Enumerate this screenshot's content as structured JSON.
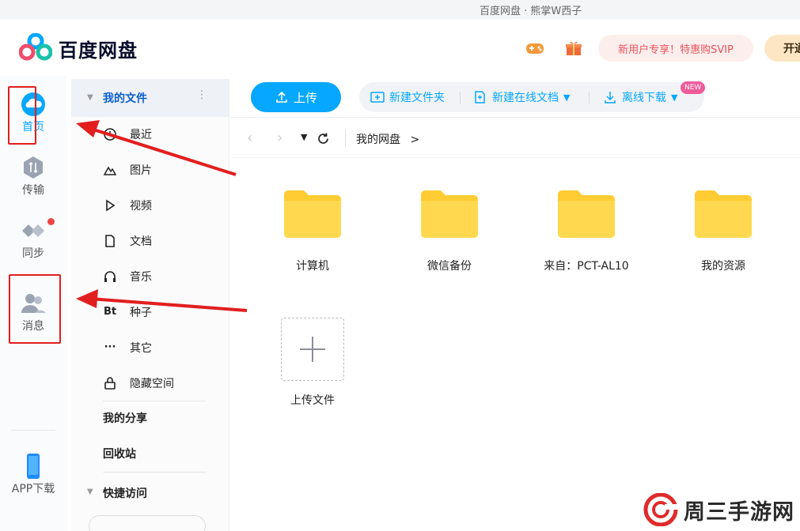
{
  "window": {
    "title": "百度网盘 · 熊掌W西子"
  },
  "header": {
    "brand": "百度网盘",
    "promo": "新用户专享！特惠购SVIP",
    "open_label": "开通"
  },
  "leftnav": [
    {
      "label": "首页"
    },
    {
      "label": "传输"
    },
    {
      "label": "同步"
    },
    {
      "label": "消息"
    },
    {
      "label": "APP下载"
    }
  ],
  "sidebar": {
    "my_files": "我的文件",
    "items": [
      {
        "label": "最近",
        "icon": "clock-icon"
      },
      {
        "label": "图片",
        "icon": "image-icon"
      },
      {
        "label": "视频",
        "icon": "video-icon"
      },
      {
        "label": "文档",
        "icon": "document-icon"
      },
      {
        "label": "音乐",
        "icon": "headphones-icon"
      },
      {
        "label": "种子",
        "icon": "bt-icon",
        "glyph": "Bt"
      },
      {
        "label": "其它",
        "icon": "more-icon",
        "glyph": "···"
      },
      {
        "label": "隐藏空间",
        "icon": "lock-icon"
      }
    ],
    "share": "我的分享",
    "trash": "回收站",
    "quick_access": "快捷访问"
  },
  "toolbar": {
    "upload": "上传",
    "new_folder": "新建文件夹",
    "new_online_doc": "新建在线文档",
    "new_badge": "NEW",
    "offline_download": "离线下载"
  },
  "breadcrumb": {
    "path": "我的网盘",
    "separator": ">"
  },
  "folders": [
    {
      "name": "计算机"
    },
    {
      "name": "微信备份"
    },
    {
      "name": "来自：PCT-AL10"
    },
    {
      "name": "我的资源"
    }
  ],
  "upload_tile": {
    "label": "上传文件"
  },
  "watermark": {
    "text": "周三手游网"
  },
  "colors": {
    "accent": "#06a7ff",
    "folder": "#ffd84f",
    "annotation": "#e21e1e"
  }
}
